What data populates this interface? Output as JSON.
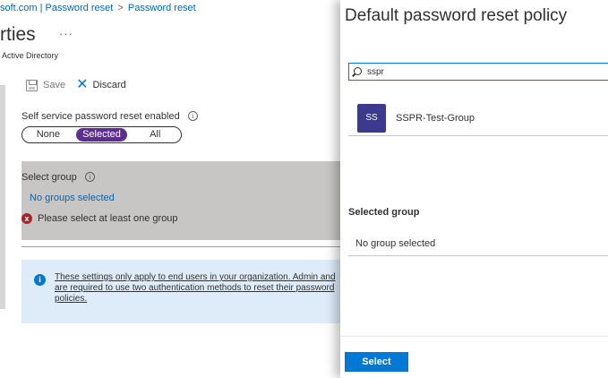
{
  "breadcrumb": {
    "items": [
      "soft.com | Password reset",
      "Password reset"
    ],
    "separator": ">"
  },
  "page": {
    "title": "rties",
    "more": "···",
    "subtitle": "Active Directory"
  },
  "toolbar": {
    "save_label": "Save",
    "discard_label": "Discard"
  },
  "sspr": {
    "label": "Self service password reset enabled",
    "info": "i",
    "options": [
      "None",
      "Selected",
      "All"
    ],
    "selected_option": "Selected"
  },
  "group": {
    "label": "Select group",
    "info": "i",
    "link": "No groups selected",
    "error": "Please select at least one group",
    "error_icon": "x"
  },
  "infobox": {
    "icon": "i",
    "text": "These settings only apply to end users in your organization. Admin and are required to use two authentication methods to reset their password policies."
  },
  "panel": {
    "title": "Default password reset policy",
    "search_value": "sspr",
    "results": [
      {
        "initials": "SS",
        "name": "SSPR-Test-Group"
      }
    ],
    "selected_heading": "Selected group",
    "selected_value": "No group selected",
    "select_button": "Select"
  },
  "colors": {
    "accent": "#0078d4",
    "toggle_active": "#5c2e91",
    "avatar": "#3b3a8f",
    "error": "#a4262c",
    "infobox_bg": "#deecf9"
  }
}
